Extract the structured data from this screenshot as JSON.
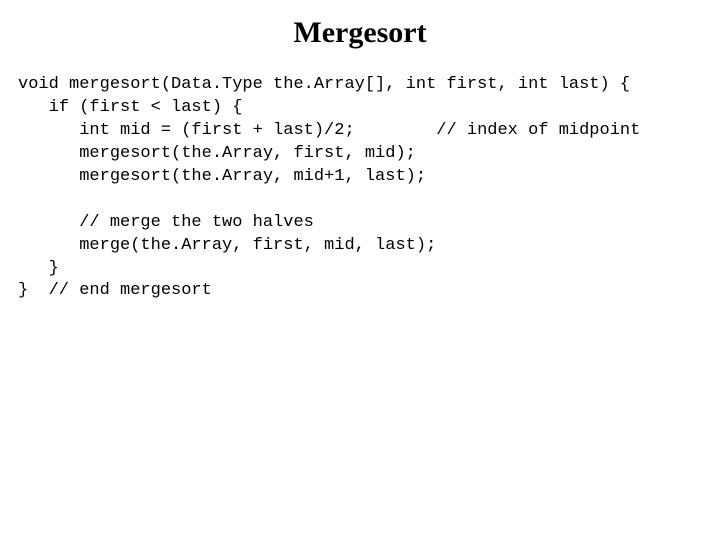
{
  "title": "Mergesort",
  "code": "void mergesort(Data.Type the.Array[], int first, int last) {\n   if (first < last) {\n      int mid = (first + last)/2;        // index of midpoint\n      mergesort(the.Array, first, mid);\n      mergesort(the.Array, mid+1, last);\n\n      // merge the two halves\n      merge(the.Array, first, mid, last);\n   }\n}  // end mergesort"
}
